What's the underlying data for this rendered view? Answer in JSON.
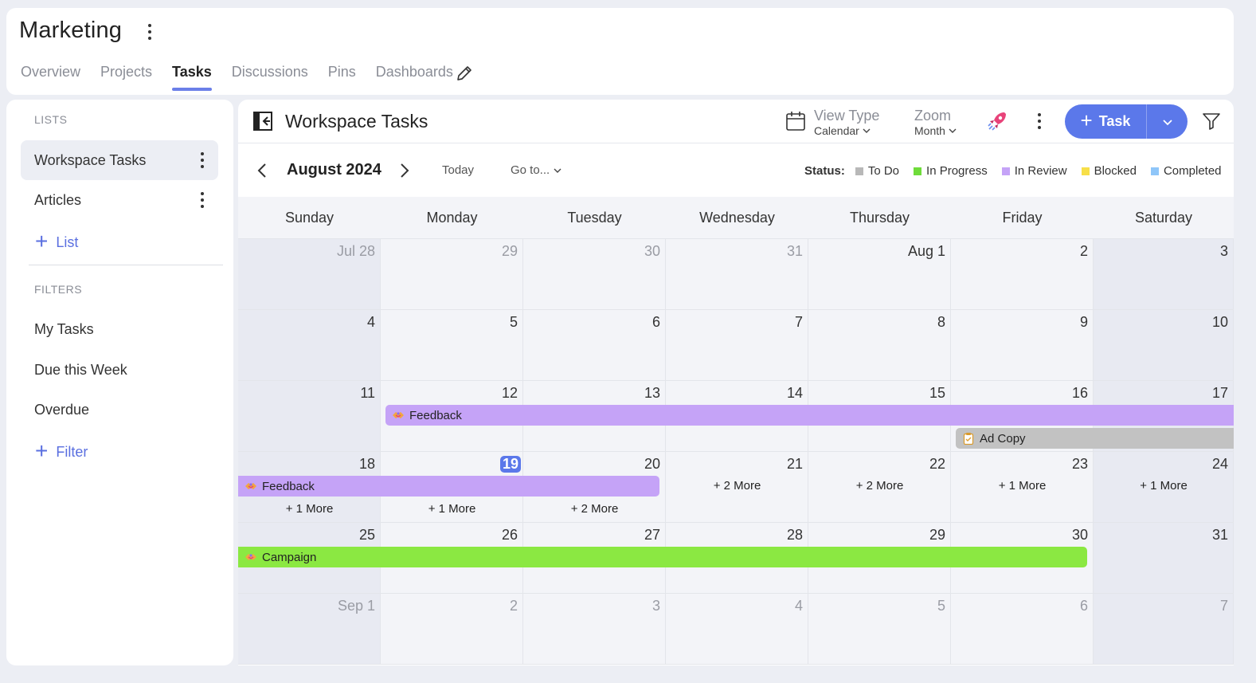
{
  "workspace": {
    "title": "Marketing"
  },
  "tabs": [
    {
      "label": "Overview",
      "active": false
    },
    {
      "label": "Projects",
      "active": false
    },
    {
      "label": "Tasks",
      "active": true
    },
    {
      "label": "Discussions",
      "active": false
    },
    {
      "label": "Pins",
      "active": false
    },
    {
      "label": "Dashboards",
      "active": false
    }
  ],
  "sidebar": {
    "lists_title": "LISTS",
    "lists": [
      {
        "label": "Workspace Tasks",
        "active": true
      },
      {
        "label": "Articles",
        "active": false
      }
    ],
    "add_list_label": "List",
    "filters_title": "FILTERS",
    "filters": [
      {
        "label": "My Tasks"
      },
      {
        "label": "Due this Week"
      },
      {
        "label": "Overdue"
      }
    ],
    "add_filter_label": "Filter"
  },
  "main": {
    "title": "Workspace Tasks",
    "view_type": {
      "label": "View Type",
      "value": "Calendar"
    },
    "zoom": {
      "label": "Zoom",
      "value": "Month"
    },
    "task_button_label": "Task"
  },
  "calendar": {
    "month_label": "August 2024",
    "today_label": "Today",
    "goto_label": "Go to...",
    "status_label": "Status:",
    "statuses": [
      {
        "label": "To Do",
        "color": "#b8b8b8"
      },
      {
        "label": "In Progress",
        "color": "#6fdc3a"
      },
      {
        "label": "In Review",
        "color": "#c5a3f7"
      },
      {
        "label": "Blocked",
        "color": "#f7df48"
      },
      {
        "label": "Completed",
        "color": "#8fc6f9"
      }
    ],
    "weekdays": [
      "Sunday",
      "Monday",
      "Tuesday",
      "Wednesday",
      "Thursday",
      "Friday",
      "Saturday"
    ],
    "weeks": [
      [
        "Jul 28",
        "29",
        "30",
        "31",
        "Aug 1",
        "2",
        "3"
      ],
      [
        "4",
        "5",
        "6",
        "7",
        "8",
        "9",
        "10"
      ],
      [
        "11",
        "12",
        "13",
        "14",
        "15",
        "16",
        "17"
      ],
      [
        "18",
        "19",
        "20",
        "21",
        "22",
        "23",
        "24"
      ],
      [
        "25",
        "26",
        "27",
        "28",
        "29",
        "30",
        "31"
      ],
      [
        "Sep 1",
        "2",
        "3",
        "4",
        "5",
        "6",
        "7"
      ]
    ],
    "today_date": "19",
    "events": [
      {
        "name": "Feedback",
        "color": "#c5a3f7",
        "icon": "handshake-icon"
      },
      {
        "name": "Ad Copy",
        "color": "#c2c2c2",
        "icon": "clipboard-icon"
      },
      {
        "name": "Feedback",
        "color": "#c5a3f7",
        "icon": "handshake-icon"
      },
      {
        "name": "Campaign",
        "color": "#8be842",
        "icon": "handshake-icon"
      }
    ],
    "more_links": [
      {
        "label": "+ 1 More"
      },
      {
        "label": "+ 1 More"
      },
      {
        "label": "+ 2 More"
      },
      {
        "label": "+ 2 More"
      },
      {
        "label": "+ 2 More"
      },
      {
        "label": "+ 1 More"
      },
      {
        "label": "+ 1 More"
      }
    ]
  }
}
